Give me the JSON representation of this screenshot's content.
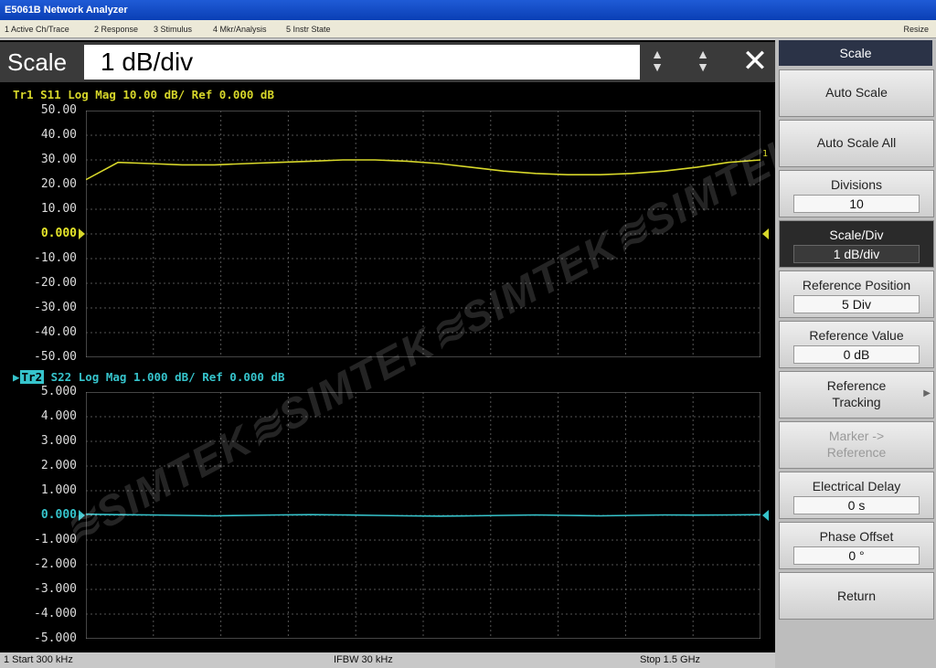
{
  "window": {
    "title": "E5061B Network Analyzer"
  },
  "menu": {
    "items": [
      "1 Active Ch/Trace",
      "2 Response",
      "3 Stimulus",
      "4 Mkr/Analysis",
      "5 Instr State"
    ],
    "resize": "Resize"
  },
  "entry": {
    "label": "Scale",
    "value": "1 dB/div",
    "up": "▲",
    "down": "▼",
    "close": "✕"
  },
  "trace1": {
    "badge": "Tr1",
    "header": " S11 Log Mag 10.00 dB/ Ref 0.000 dB",
    "yticks": [
      "50.00",
      "40.00",
      "30.00",
      "20.00",
      "10.00",
      "0.000",
      "-10.00",
      "-20.00",
      "-30.00",
      "-40.00",
      "-50.00"
    ],
    "color": "#d7d72a",
    "ref_index": 5,
    "marker_label": "1",
    "data_db": [
      22,
      29,
      28.5,
      28,
      28,
      28.5,
      29,
      29.5,
      30,
      30,
      29.5,
      28.5,
      27,
      25.5,
      24.5,
      24,
      24,
      24.5,
      25.5,
      27,
      29,
      30
    ]
  },
  "trace2": {
    "badge": "Tr2",
    "header": " S22 Log Mag 1.000 dB/ Ref 0.000 dB",
    "yticks": [
      "5.000",
      "4.000",
      "3.000",
      "2.000",
      "1.000",
      "0.000",
      "-1.000",
      "-2.000",
      "-3.000",
      "-4.000",
      "-5.000"
    ],
    "color": "#36c4cc",
    "ref_index": 5,
    "data_db": [
      0.05,
      0.03,
      0.02,
      0.0,
      -0.02,
      0.0,
      0.02,
      0.03,
      0.02,
      0.0,
      -0.02,
      -0.03,
      -0.02,
      0.0,
      0.02,
      0.0,
      -0.02,
      0.0,
      0.02,
      0.01,
      0.02,
      0.03
    ]
  },
  "status": {
    "start": "1  Start 300 kHz",
    "ifbw": "IFBW 30 kHz",
    "stop": "Stop 1.5 GHz"
  },
  "softkeys": {
    "title": "Scale",
    "auto_scale": "Auto Scale",
    "auto_scale_all": "Auto Scale All",
    "divisions": {
      "label": "Divisions",
      "value": "10"
    },
    "scale_div": {
      "label": "Scale/Div",
      "value": "1 dB/div"
    },
    "ref_position": {
      "label": "Reference Position",
      "value": "5 Div"
    },
    "ref_value": {
      "label": "Reference Value",
      "value": "0 dB"
    },
    "ref_tracking": {
      "line1": "Reference",
      "line2": "Tracking"
    },
    "marker_ref": {
      "line1": "Marker ->",
      "line2": "Reference"
    },
    "electrical_delay": {
      "label": "Electrical Delay",
      "value": "0 s"
    },
    "phase_offset": {
      "label": "Phase Offset",
      "value": "0 °"
    },
    "return": "Return"
  },
  "watermark": "SIMTEK"
}
